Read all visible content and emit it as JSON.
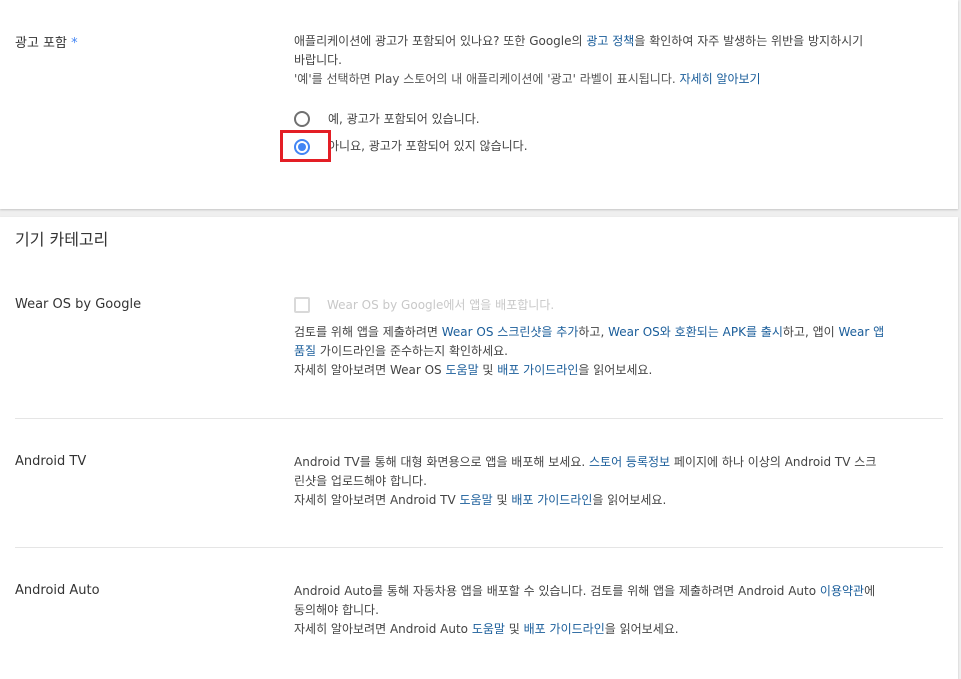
{
  "ads": {
    "label": "광고 포함",
    "required_mark": "*",
    "desc_line1_a": "애플리케이션에 광고가 포함되어 있나요? 또한 Google의 ",
    "desc_line1_link": "광고 정책",
    "desc_line1_b": "을 확인하여 자주 발생하는 위반을 방지하시기",
    "desc_line2": "바랍니다.",
    "note_text": "'예'를 선택하면 Play 스토어의 내 애플리케이션에 '광고' 라벨이 표시됩니다. ",
    "note_link": "자세히 알아보기",
    "option_yes": "예, 광고가 포함되어 있습니다.",
    "option_no": "아니요, 광고가 포함되어 있지 않습니다.",
    "selected": "no"
  },
  "device_categories": {
    "title": "기기 카테고리",
    "wear": {
      "label": "Wear OS by Google",
      "checkbox_label": "Wear OS by Google에서 앱을 배포합니다.",
      "checkbox_checked": false,
      "l1_a": "검토를 위해 앱을 제출하려면 ",
      "l1_link1": "Wear OS 스크린샷을 추가",
      "l1_b": "하고, ",
      "l1_link2": "Wear OS와 호환되는 APK를 출시",
      "l1_c": "하고, 앱이 ",
      "l1_link3": "Wear 앱",
      "l2_link": "품질",
      "l2_b": " 가이드라인을 준수하는지 확인하세요.",
      "l3_a": "자세히 알아보려면 Wear OS ",
      "l3_link1": "도움말",
      "l3_b": " 및 ",
      "l3_link2": "배포 가이드라인",
      "l3_c": "을 읽어보세요."
    },
    "tv": {
      "label": "Android TV",
      "l1_a": "Android TV를 통해 대형 화면용으로 앱을 배포해 보세요. ",
      "l1_link": "스토어 등록정보",
      "l1_b": " 페이지에 하나 이상의 Android TV 스크",
      "l2": "린샷을 업로드해야 합니다.",
      "l3_a": "자세히 알아보려면 Android TV ",
      "l3_link1": "도움말",
      "l3_b": " 및 ",
      "l3_link2": "배포 가이드라인",
      "l3_c": "을 읽어보세요."
    },
    "auto": {
      "label": "Android Auto",
      "l1_a": "Android Auto를 통해 자동차용 앱을 배포할 수 있습니다. 검토를 위해 앱을 제출하려면 Android Auto ",
      "l1_link": "이용약관",
      "l1_b": "에",
      "l2": "동의해야 합니다.",
      "l3_a": "자세히 알아보려면 Android Auto ",
      "l3_link1": "도움말",
      "l3_b": " 및 ",
      "l3_link2": "배포 가이드라인",
      "l3_c": "을 읽어보세요."
    }
  },
  "colors": {
    "link": "#1a5d9a",
    "accent": "#4285f4",
    "highlight": "#e31e25"
  }
}
